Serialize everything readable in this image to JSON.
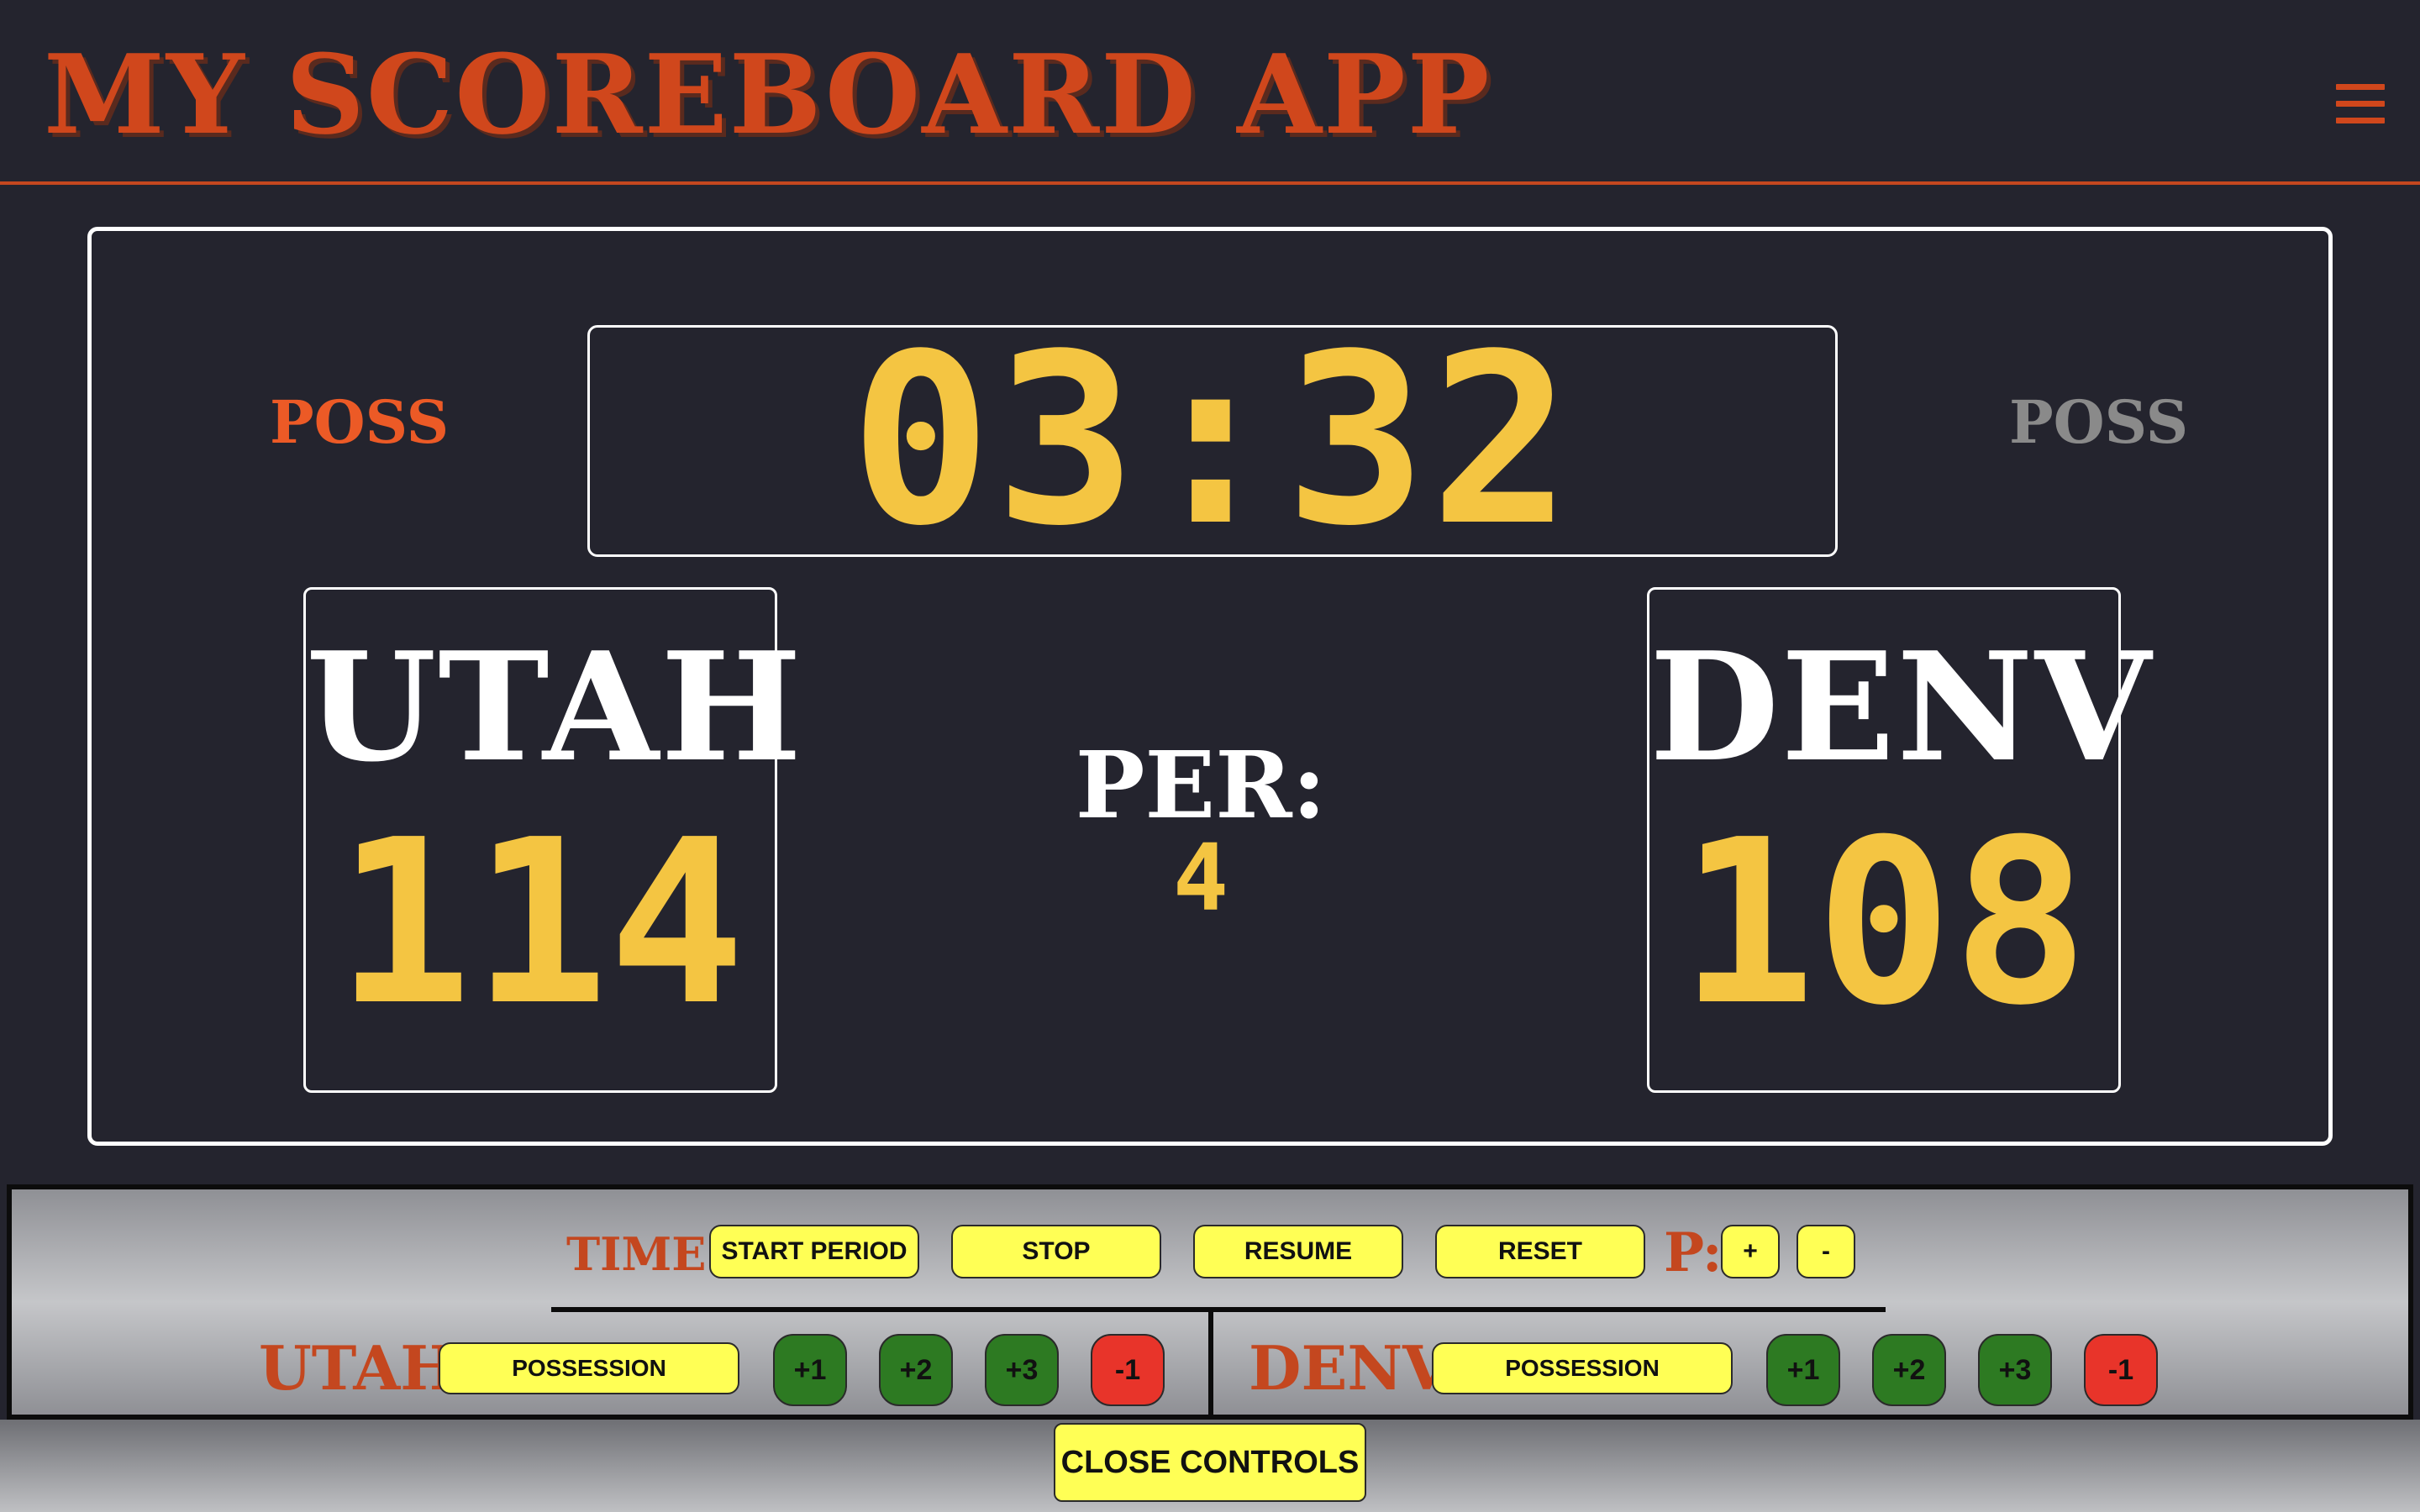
{
  "app": {
    "title": "MY SCOREBOARD APP",
    "menu_icon": "hamburger-menu-icon"
  },
  "colors": {
    "background": "#24242e",
    "accent": "#d0471c",
    "score_yellow": "#f4c542",
    "button_yellow": "#ffff55",
    "score_up_green": "#2d7a22",
    "score_down_red": "#e8342a",
    "poss_active": "#ec5a26",
    "poss_inactive": "#8a8a8a"
  },
  "scoreboard": {
    "clock": "03:32",
    "period_label": "PER:",
    "period_value": "4",
    "home": {
      "name": "UTAH",
      "score": "114",
      "poss_label": "POSS",
      "has_possession": true
    },
    "away": {
      "name": "DENV",
      "score": "108",
      "poss_label": "POSS",
      "has_possession": false
    }
  },
  "controls": {
    "time_label": "TIME:",
    "start_period": "START PERIOD",
    "stop": "STOP",
    "resume": "RESUME",
    "reset": "RESET",
    "period_label": "P:",
    "period_plus": "+",
    "period_minus": "-",
    "home": {
      "name": "UTAH",
      "possession": "POSSESSION",
      "plus1": "+1",
      "plus2": "+2",
      "plus3": "+3",
      "minus1": "-1"
    },
    "away": {
      "name": "DENV",
      "possession": "POSSESSION",
      "plus1": "+1",
      "plus2": "+2",
      "plus3": "+3",
      "minus1": "-1"
    },
    "close": "CLOSE CONTROLS"
  }
}
